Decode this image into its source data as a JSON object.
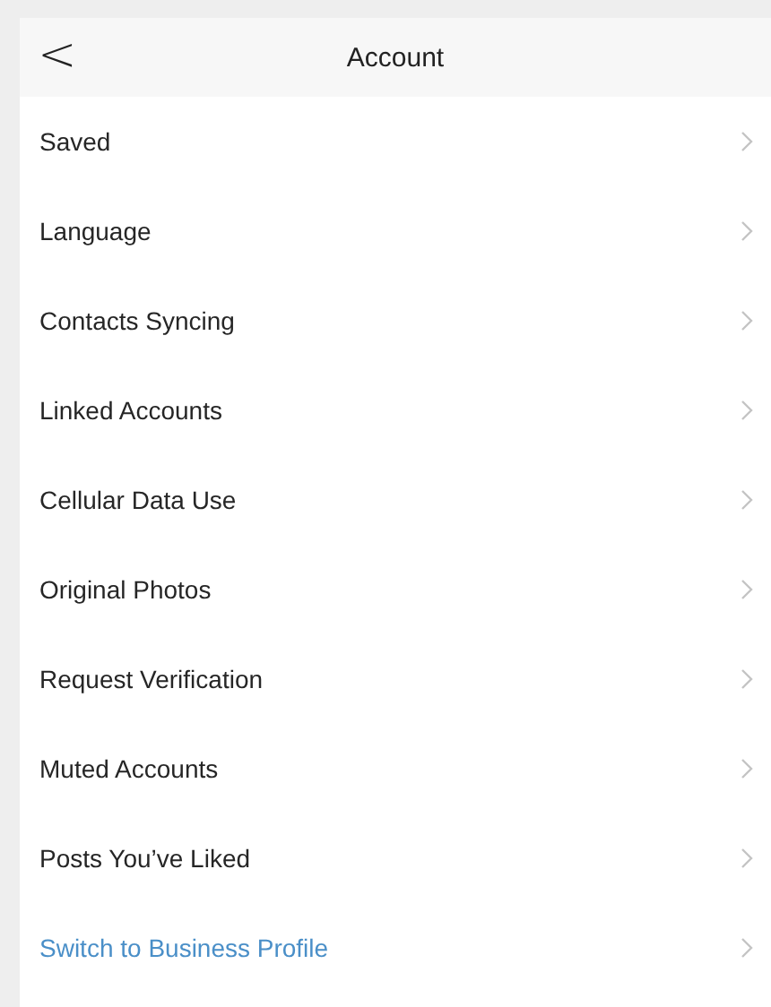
{
  "header": {
    "title": "Account",
    "back_symbol": "<"
  },
  "items": [
    {
      "label": "Saved",
      "kind": "setting"
    },
    {
      "label": "Language",
      "kind": "setting"
    },
    {
      "label": "Contacts Syncing",
      "kind": "setting"
    },
    {
      "label": "Linked Accounts",
      "kind": "setting"
    },
    {
      "label": "Cellular Data Use",
      "kind": "setting"
    },
    {
      "label": "Original Photos",
      "kind": "setting"
    },
    {
      "label": "Request Verification",
      "kind": "setting"
    },
    {
      "label": "Muted Accounts",
      "kind": "setting"
    },
    {
      "label": "Posts You’ve Liked",
      "kind": "setting"
    },
    {
      "label": "Switch to Business Profile",
      "kind": "link"
    }
  ]
}
